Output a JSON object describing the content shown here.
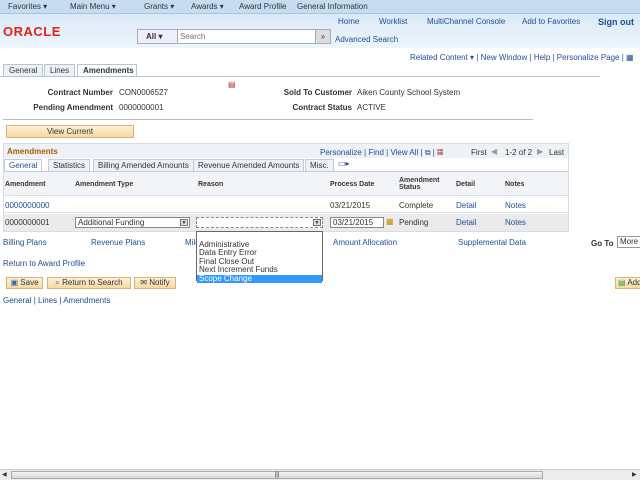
{
  "nav": {
    "favorites": "Favorites ▾",
    "main_menu": "Main Menu ▾",
    "crumbs": [
      "Grants ▾",
      "Awards ▾",
      "Award Profile",
      "General Information"
    ]
  },
  "header": {
    "logo": "ORACLE",
    "links": [
      "Home",
      "Worklist",
      "MultiChannel Console",
      "Add to Favorites",
      "Sign out"
    ],
    "search_scope": "All",
    "search_placeholder": "Search",
    "advanced_search": "Advanced Search"
  },
  "page_links": {
    "related": "Related Content ▾",
    "new_window": "New Window",
    "help": "Help",
    "personalize": "Personalize Page"
  },
  "tabs": [
    "General",
    "Lines",
    "Amendments"
  ],
  "contract": {
    "number_label": "Contract Number",
    "number": "CON0006527",
    "pending_label": "Pending Amendment",
    "pending": "0000000001",
    "customer_label": "Sold To Customer",
    "customer": "Aiken County School System",
    "status_label": "Contract Status",
    "status": "ACTIVE"
  },
  "view_current": "View Current",
  "grid": {
    "title": "Amendments",
    "personalize": "Personalize",
    "find": "Find",
    "view_all": "View All",
    "first": "First",
    "range": "1-2 of 2",
    "last": "Last",
    "tabs": [
      "General",
      "Statistics",
      "Billing Amended Amounts",
      "Revenue Amended Amounts",
      "Misc."
    ],
    "columns": [
      "Amendment",
      "Amendment Type",
      "Reason",
      "Process Date",
      "Amendment Status",
      "Detail",
      "Notes"
    ],
    "rows": [
      {
        "amendment": "0000000000",
        "type": "",
        "reason": "",
        "date": "03/21/2015",
        "status": "Complete",
        "detail": "Detail",
        "notes": "Notes"
      },
      {
        "amendment": "0000000001",
        "type": "Additional Funding",
        "reason": "",
        "date": "03/21/2015",
        "status": "Pending",
        "detail": "Detail",
        "notes": "Notes"
      }
    ]
  },
  "reason_options": [
    "",
    "Administrative",
    "Data Entry Error",
    "Final Close Out",
    "Next Increment Funds",
    "Scope Change"
  ],
  "reason_highlighted": "Scope Change",
  "sublinks": [
    "Billing Plans",
    "Revenue Plans",
    "Mile",
    "Amount Allocation",
    "Supplemental Data"
  ],
  "goto_label": "Go To",
  "goto_value": "More",
  "return_link": "Return to Award Profile",
  "buttons": {
    "save": "Save",
    "return_search": "Return to Search",
    "notify": "Notify",
    "add": "Add"
  },
  "footer_links": [
    "General",
    "Lines",
    "Amendments"
  ]
}
